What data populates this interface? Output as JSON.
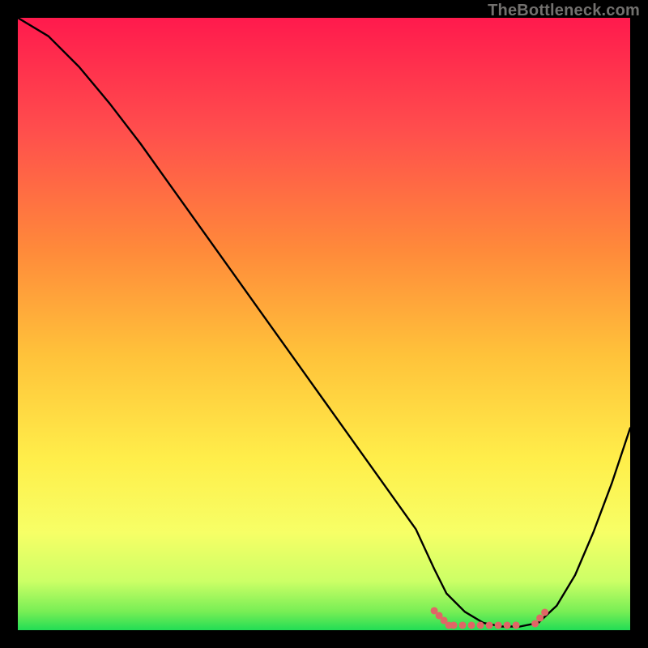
{
  "watermark": "TheBottleneck.com",
  "colors": {
    "black": "#000000",
    "curve": "#000000",
    "marker": "#e06666",
    "grad_top": "#ff1a4d",
    "grad_mid1": "#ff6a3c",
    "grad_mid2": "#ffd23a",
    "grad_mid3": "#ffff66",
    "grad_mid4": "#e6ff66",
    "grad_bot": "#22dd55"
  },
  "chart_data": {
    "type": "line",
    "title": "",
    "xlabel": "",
    "ylabel": "",
    "xlim": [
      0,
      100
    ],
    "ylim": [
      0,
      100
    ],
    "grid": false,
    "legend": false,
    "series": [
      {
        "name": "curve",
        "x": [
          0,
          5,
          10,
          15,
          20,
          25,
          30,
          35,
          40,
          45,
          50,
          55,
          60,
          65,
          68,
          70,
          73,
          76,
          79,
          82,
          85,
          88,
          91,
          94,
          97,
          100
        ],
        "values": [
          100,
          97,
          92,
          86,
          79.5,
          72.5,
          65.5,
          58.5,
          51.5,
          44.5,
          37.5,
          30.5,
          23.5,
          16.5,
          10,
          6,
          3,
          1.2,
          0.6,
          0.6,
          1.2,
          4,
          9,
          16,
          24,
          33
        ]
      }
    ],
    "markers": {
      "comment": "flat-bottom highlighted region (approximate x span and y level)",
      "x_start": 68,
      "x_end": 85,
      "y": 0.8
    }
  }
}
